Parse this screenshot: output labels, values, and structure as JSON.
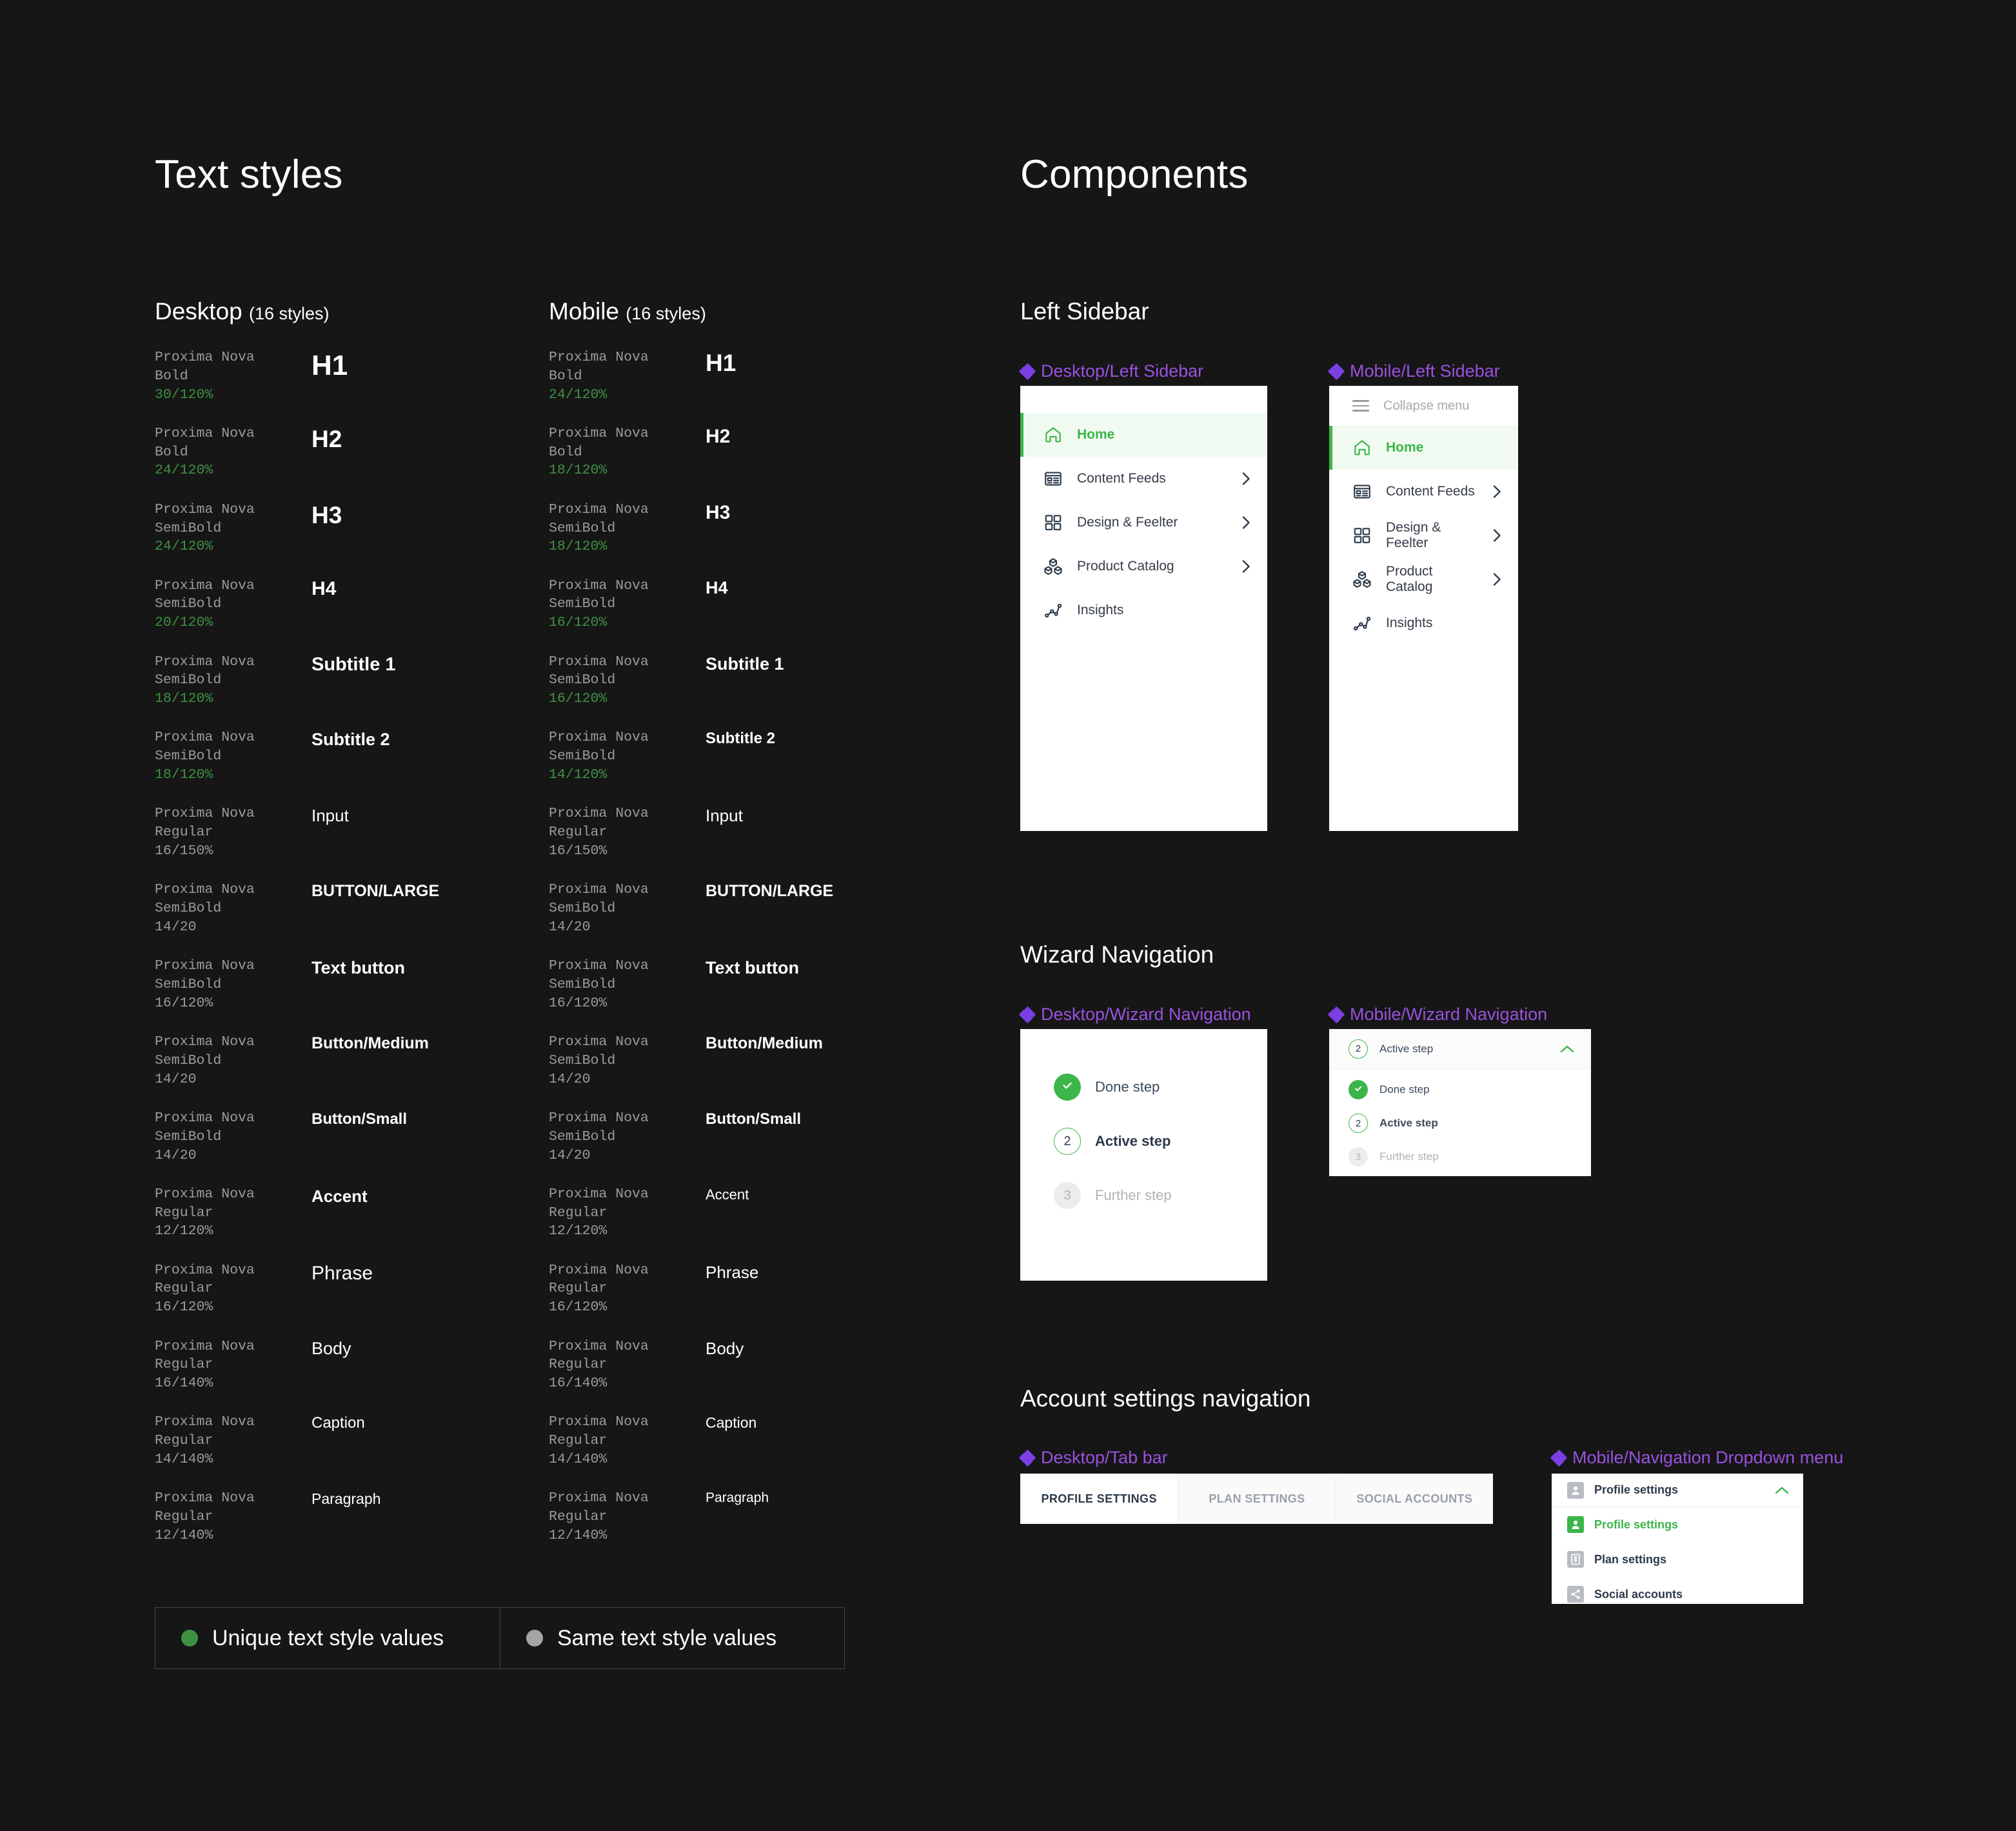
{
  "boards": {
    "text_styles_title": "Text styles",
    "components_title": "Components"
  },
  "text_styles": {
    "desktop": {
      "heading": "Desktop",
      "count_label": "(16 styles)",
      "rows": [
        {
          "family": "Proxima Nova",
          "weight": "Bold",
          "size": "30/120%",
          "unique": true,
          "sample": "H1",
          "sample_size": 44,
          "sample_weight": 700
        },
        {
          "family": "Proxima Nova",
          "weight": "Bold",
          "size": "24/120%",
          "unique": true,
          "sample": "H2",
          "sample_size": 37,
          "sample_weight": 700
        },
        {
          "family": "Proxima Nova",
          "weight": "SemiBold",
          "size": "24/120%",
          "unique": true,
          "sample": "H3",
          "sample_size": 37,
          "sample_weight": 600
        },
        {
          "family": "Proxima Nova",
          "weight": "SemiBold",
          "size": "20/120%",
          "unique": true,
          "sample": "H4",
          "sample_size": 30,
          "sample_weight": 600
        },
        {
          "family": "Proxima Nova",
          "weight": "SemiBold",
          "size": "18/120%",
          "unique": true,
          "sample": "Subtitle 1",
          "sample_size": 29,
          "sample_weight": 600
        },
        {
          "family": "Proxima Nova",
          "weight": "SemiBold",
          "size": "18/120%",
          "unique": true,
          "sample": "Subtitle 2",
          "sample_size": 27,
          "sample_weight": 600
        },
        {
          "family": "Proxima Nova",
          "weight": "Regular",
          "size": "16/150%",
          "unique": false,
          "sample": "Input",
          "sample_size": 26,
          "sample_weight": 400
        },
        {
          "family": "Proxima Nova",
          "weight": "SemiBold",
          "size": "14/20",
          "unique": false,
          "sample": "BUTTON/LARGE",
          "sample_size": 25,
          "sample_weight": 700
        },
        {
          "family": "Proxima Nova",
          "weight": "SemiBold",
          "size": "16/120%",
          "unique": false,
          "sample": "Text button",
          "sample_size": 27,
          "sample_weight": 700
        },
        {
          "family": "Proxima Nova",
          "weight": "SemiBold",
          "size": "14/20",
          "unique": false,
          "sample": "Button/Medium",
          "sample_size": 25,
          "sample_weight": 700
        },
        {
          "family": "Proxima Nova",
          "weight": "SemiBold",
          "size": "14/20",
          "unique": false,
          "sample": "Button/Small",
          "sample_size": 24,
          "sample_weight": 700
        },
        {
          "family": "Proxima Nova",
          "weight": "Regular",
          "size": "12/120%",
          "unique": false,
          "sample": "Accent",
          "sample_size": 26,
          "sample_weight": 700
        },
        {
          "family": "Proxima Nova",
          "weight": "Regular",
          "size": "16/120%",
          "unique": false,
          "sample": "Phrase",
          "sample_size": 30,
          "sample_weight": 400
        },
        {
          "family": "Proxima Nova",
          "weight": "Regular",
          "size": "16/140%",
          "unique": false,
          "sample": "Body",
          "sample_size": 27,
          "sample_weight": 400
        },
        {
          "family": "Proxima Nova",
          "weight": "Regular",
          "size": "14/140%",
          "unique": false,
          "sample": "Caption",
          "sample_size": 24,
          "sample_weight": 400
        },
        {
          "family": "Proxima Nova",
          "weight": "Regular",
          "size": "12/140%",
          "unique": false,
          "sample": "Paragraph",
          "sample_size": 23,
          "sample_weight": 400
        }
      ]
    },
    "mobile": {
      "heading": "Mobile",
      "count_label": "(16 styles)",
      "rows": [
        {
          "family": "Proxima Nova",
          "weight": "Bold",
          "size": "24/120%",
          "unique": true,
          "sample": "H1",
          "sample_size": 37,
          "sample_weight": 700
        },
        {
          "family": "Proxima Nova",
          "weight": "Bold",
          "size": "18/120%",
          "unique": true,
          "sample": "H2",
          "sample_size": 30,
          "sample_weight": 700
        },
        {
          "family": "Proxima Nova",
          "weight": "SemiBold",
          "size": "18/120%",
          "unique": true,
          "sample": "H3",
          "sample_size": 30,
          "sample_weight": 600
        },
        {
          "family": "Proxima Nova",
          "weight": "SemiBold",
          "size": "16/120%",
          "unique": true,
          "sample": "H4",
          "sample_size": 27,
          "sample_weight": 600
        },
        {
          "family": "Proxima Nova",
          "weight": "SemiBold",
          "size": "16/120%",
          "unique": true,
          "sample": "Subtitle 1",
          "sample_size": 27,
          "sample_weight": 600
        },
        {
          "family": "Proxima Nova",
          "weight": "SemiBold",
          "size": "14/120%",
          "unique": true,
          "sample": "Subtitle 2",
          "sample_size": 24,
          "sample_weight": 600
        },
        {
          "family": "Proxima Nova",
          "weight": "Regular",
          "size": "16/150%",
          "unique": false,
          "sample": "Input",
          "sample_size": 26,
          "sample_weight": 400
        },
        {
          "family": "Proxima Nova",
          "weight": "SemiBold",
          "size": "14/20",
          "unique": false,
          "sample": "BUTTON/LARGE",
          "sample_size": 25,
          "sample_weight": 700
        },
        {
          "family": "Proxima Nova",
          "weight": "SemiBold",
          "size": "16/120%",
          "unique": false,
          "sample": "Text button",
          "sample_size": 27,
          "sample_weight": 700
        },
        {
          "family": "Proxima Nova",
          "weight": "SemiBold",
          "size": "14/20",
          "unique": false,
          "sample": "Button/Medium",
          "sample_size": 25,
          "sample_weight": 700
        },
        {
          "family": "Proxima Nova",
          "weight": "SemiBold",
          "size": "14/20",
          "unique": false,
          "sample": "Button/Small",
          "sample_size": 24,
          "sample_weight": 700
        },
        {
          "family": "Proxima Nova",
          "weight": "Regular",
          "size": "12/120%",
          "unique": false,
          "sample": "Accent",
          "sample_size": 22,
          "sample_weight": 400
        },
        {
          "family": "Proxima Nova",
          "weight": "Regular",
          "size": "16/120%",
          "unique": false,
          "sample": "Phrase",
          "sample_size": 26,
          "sample_weight": 400
        },
        {
          "family": "Proxima Nova",
          "weight": "Regular",
          "size": "16/140%",
          "unique": false,
          "sample": "Body",
          "sample_size": 26,
          "sample_weight": 400
        },
        {
          "family": "Proxima Nova",
          "weight": "Regular",
          "size": "14/140%",
          "unique": false,
          "sample": "Caption",
          "sample_size": 23,
          "sample_weight": 400
        },
        {
          "family": "Proxima Nova",
          "weight": "Regular",
          "size": "12/140%",
          "unique": false,
          "sample": "Paragraph",
          "sample_size": 21,
          "sample_weight": 400
        }
      ]
    },
    "legend": [
      {
        "label": "Unique text style values",
        "color": "#3f9142"
      },
      {
        "label": "Same text style values",
        "color": "#a5a5a5"
      }
    ]
  },
  "components": {
    "left_sidebar": {
      "group_title": "Left Sidebar",
      "desktop_name": "Desktop/Left Sidebar",
      "mobile_name": "Mobile/Left Sidebar",
      "collapse_label": "Collapse menu",
      "items": [
        {
          "label": "Home",
          "icon": "home-icon",
          "active": true,
          "chevron": false
        },
        {
          "label": "Content Feeds",
          "icon": "content-feeds-icon",
          "active": false,
          "chevron": true
        },
        {
          "label": "Design & Feelter",
          "icon": "design-grid-icon",
          "active": false,
          "chevron": true
        },
        {
          "label": "Product Catalog",
          "icon": "product-catalog-icon",
          "active": false,
          "chevron": true
        },
        {
          "label": "Insights",
          "icon": "insights-icon",
          "active": false,
          "chevron": false
        }
      ]
    },
    "wizard_navigation": {
      "group_title": "Wizard Navigation",
      "desktop_name": "Desktop/Wizard Navigation",
      "mobile_name": "Mobile/Wizard Navigation",
      "steps": [
        {
          "badge": "check",
          "label": "Done step",
          "state": "done"
        },
        {
          "badge": "2",
          "label": "Active step",
          "state": "active"
        },
        {
          "badge": "3",
          "label": "Further step",
          "state": "further"
        }
      ],
      "mobile_header": {
        "badge": "2",
        "label": "Active step",
        "chevron": "chevron-up-icon"
      }
    },
    "account_settings": {
      "group_title": "Account settings navigation",
      "desktop_name": "Desktop/Tab bar",
      "mobile_name": "Mobile/Navigation Dropdown menu",
      "tabs": [
        {
          "label": "PROFILE SETTINGS",
          "active": true
        },
        {
          "label": "PLAN SETTINGS",
          "active": false
        },
        {
          "label": "SOCIAL ACCOUNTS",
          "active": false
        }
      ],
      "dropdown_header": {
        "label": "Profile settings",
        "icon": "person-card-icon",
        "chevron": "chevron-up-icon"
      },
      "dropdown_items": [
        {
          "label": "Profile settings",
          "icon": "person-card-icon",
          "selected": true
        },
        {
          "label": "Plan settings",
          "icon": "billing-icon",
          "selected": false
        },
        {
          "label": "Social accounts",
          "icon": "share-icon",
          "selected": false
        }
      ]
    }
  },
  "colors": {
    "background": "#161616",
    "accent_green": "#3cb54a",
    "unique_green": "#3f9142",
    "same_grey": "#9b9b9b",
    "component_purple": "#9b51e0",
    "card_white": "#ffffff",
    "active_row_bg": "#f1faf1",
    "text_dark": "#2b3a4a",
    "muted_grey": "#b3b3b3"
  }
}
